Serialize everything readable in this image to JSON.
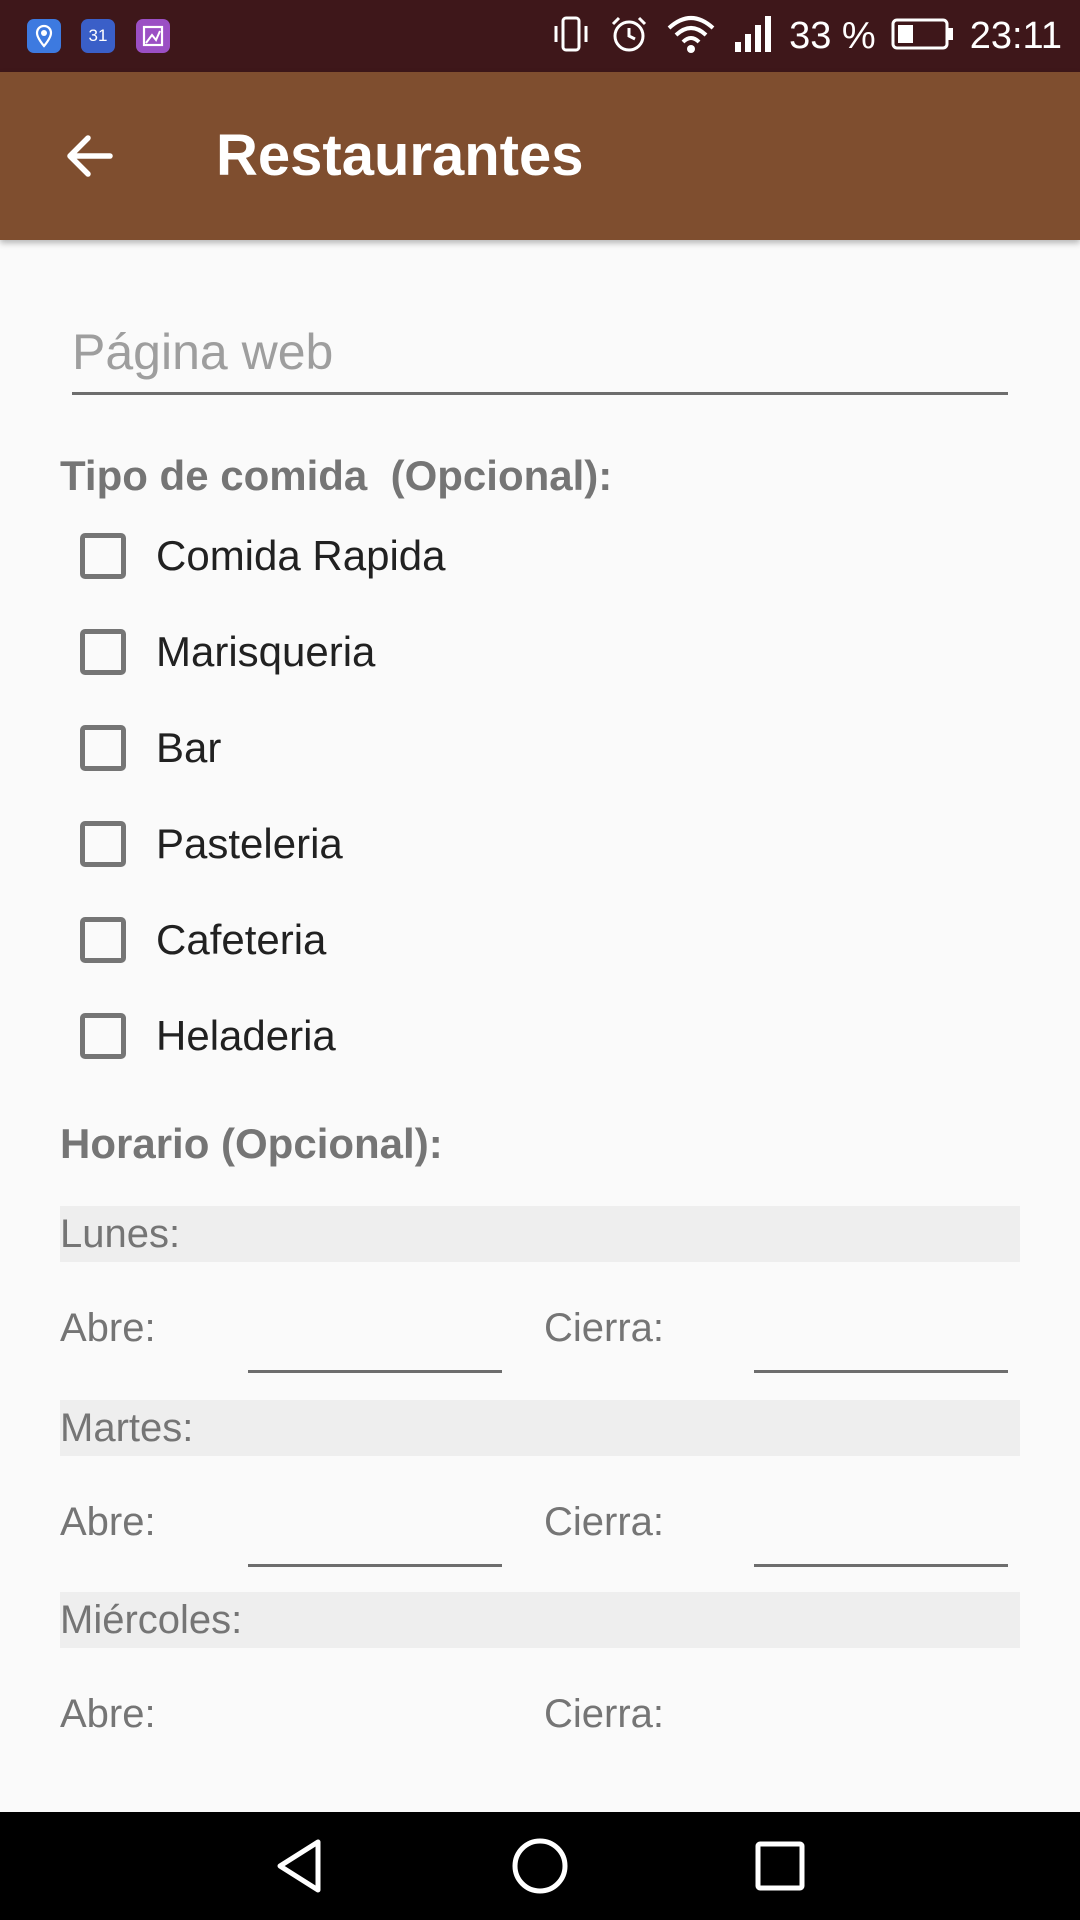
{
  "status_bar": {
    "notification_icons": [
      "maps-icon",
      "calendar-icon",
      "gallery-icon"
    ],
    "calendar_day": "31",
    "battery_percent": "33 %",
    "time": "23:11"
  },
  "app_bar": {
    "title": "Restaurantes",
    "back_icon": "arrow-back-icon",
    "color": "#7f4e2f"
  },
  "form": {
    "website": {
      "placeholder": "Página web",
      "value": ""
    },
    "food_type": {
      "label": "Tipo de comida  (Opcional):",
      "options": [
        {
          "label": "Comida Rapida",
          "checked": false
        },
        {
          "label": "Marisqueria",
          "checked": false
        },
        {
          "label": "Bar",
          "checked": false
        },
        {
          "label": "Pasteleria",
          "checked": false
        },
        {
          "label": "Cafeteria",
          "checked": false
        },
        {
          "label": "Heladeria",
          "checked": false
        }
      ]
    },
    "schedule": {
      "label": "Horario (Opcional):",
      "open_label": "Abre:",
      "close_label": "Cierra:",
      "days": [
        {
          "name": "Lunes:",
          "open": "",
          "close": ""
        },
        {
          "name": "Martes:",
          "open": "",
          "close": ""
        },
        {
          "name": "Miércoles:",
          "open": "",
          "close": ""
        }
      ]
    }
  },
  "nav_bar": {
    "buttons": [
      "back-triangle-icon",
      "home-circle-icon",
      "recents-square-icon"
    ]
  }
}
